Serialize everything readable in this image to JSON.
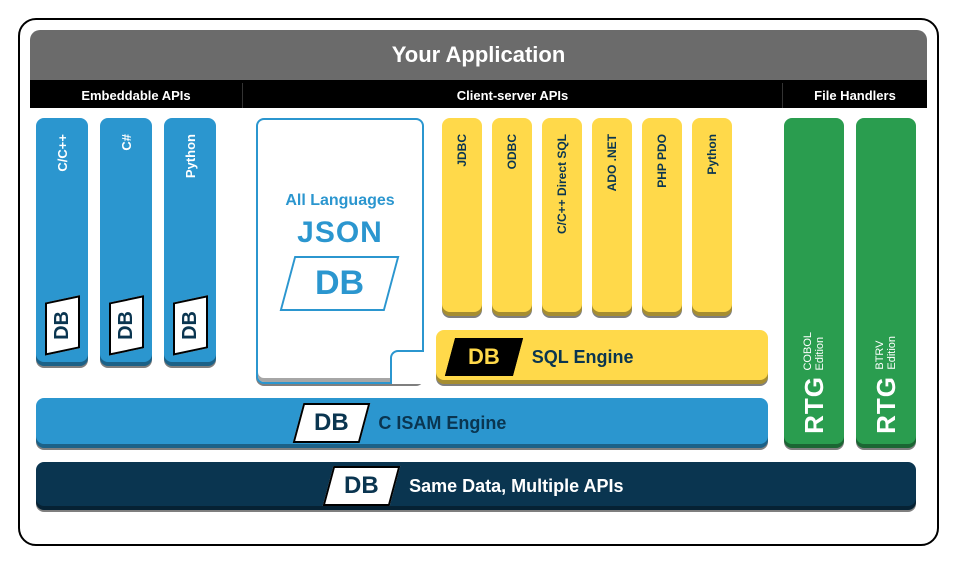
{
  "title": "Your Application",
  "sections": {
    "embeddable": "Embeddable APIs",
    "clientserver": "Client-server APIs",
    "filehandlers": "File Handlers"
  },
  "embeddable_apis": [
    {
      "label": "C/C++",
      "badge": "DB"
    },
    {
      "label": "C#",
      "badge": "DB"
    },
    {
      "label": "Python",
      "badge": "DB"
    }
  ],
  "json_card": {
    "line1": "All Languages",
    "line2": "JSON",
    "badge": "DB"
  },
  "client_apis": [
    {
      "label": "JDBC"
    },
    {
      "label": "ODBC"
    },
    {
      "label": "C/C++ Direct SQL"
    },
    {
      "label": "ADO .NET"
    },
    {
      "label": "PHP PDO"
    },
    {
      "label": "Python"
    }
  ],
  "sql_engine": {
    "badge": "DB",
    "label": "SQL Engine"
  },
  "c_isam": {
    "badge": "DB",
    "label": "C ISAM Engine"
  },
  "same_data": {
    "badge": "DB",
    "label": "Same Data, Multiple APIs"
  },
  "file_handlers": [
    {
      "badge": "RTG",
      "line1": "COBOL",
      "line2": "Edition"
    },
    {
      "badge": "RTG",
      "line1": "BTRV",
      "line2": "Edition"
    }
  ],
  "colors": {
    "blue": "#2b96cf",
    "yellow": "#ffd94a",
    "green": "#2a9d4f",
    "navy": "#0a3550",
    "gray": "#6b6b6b"
  }
}
